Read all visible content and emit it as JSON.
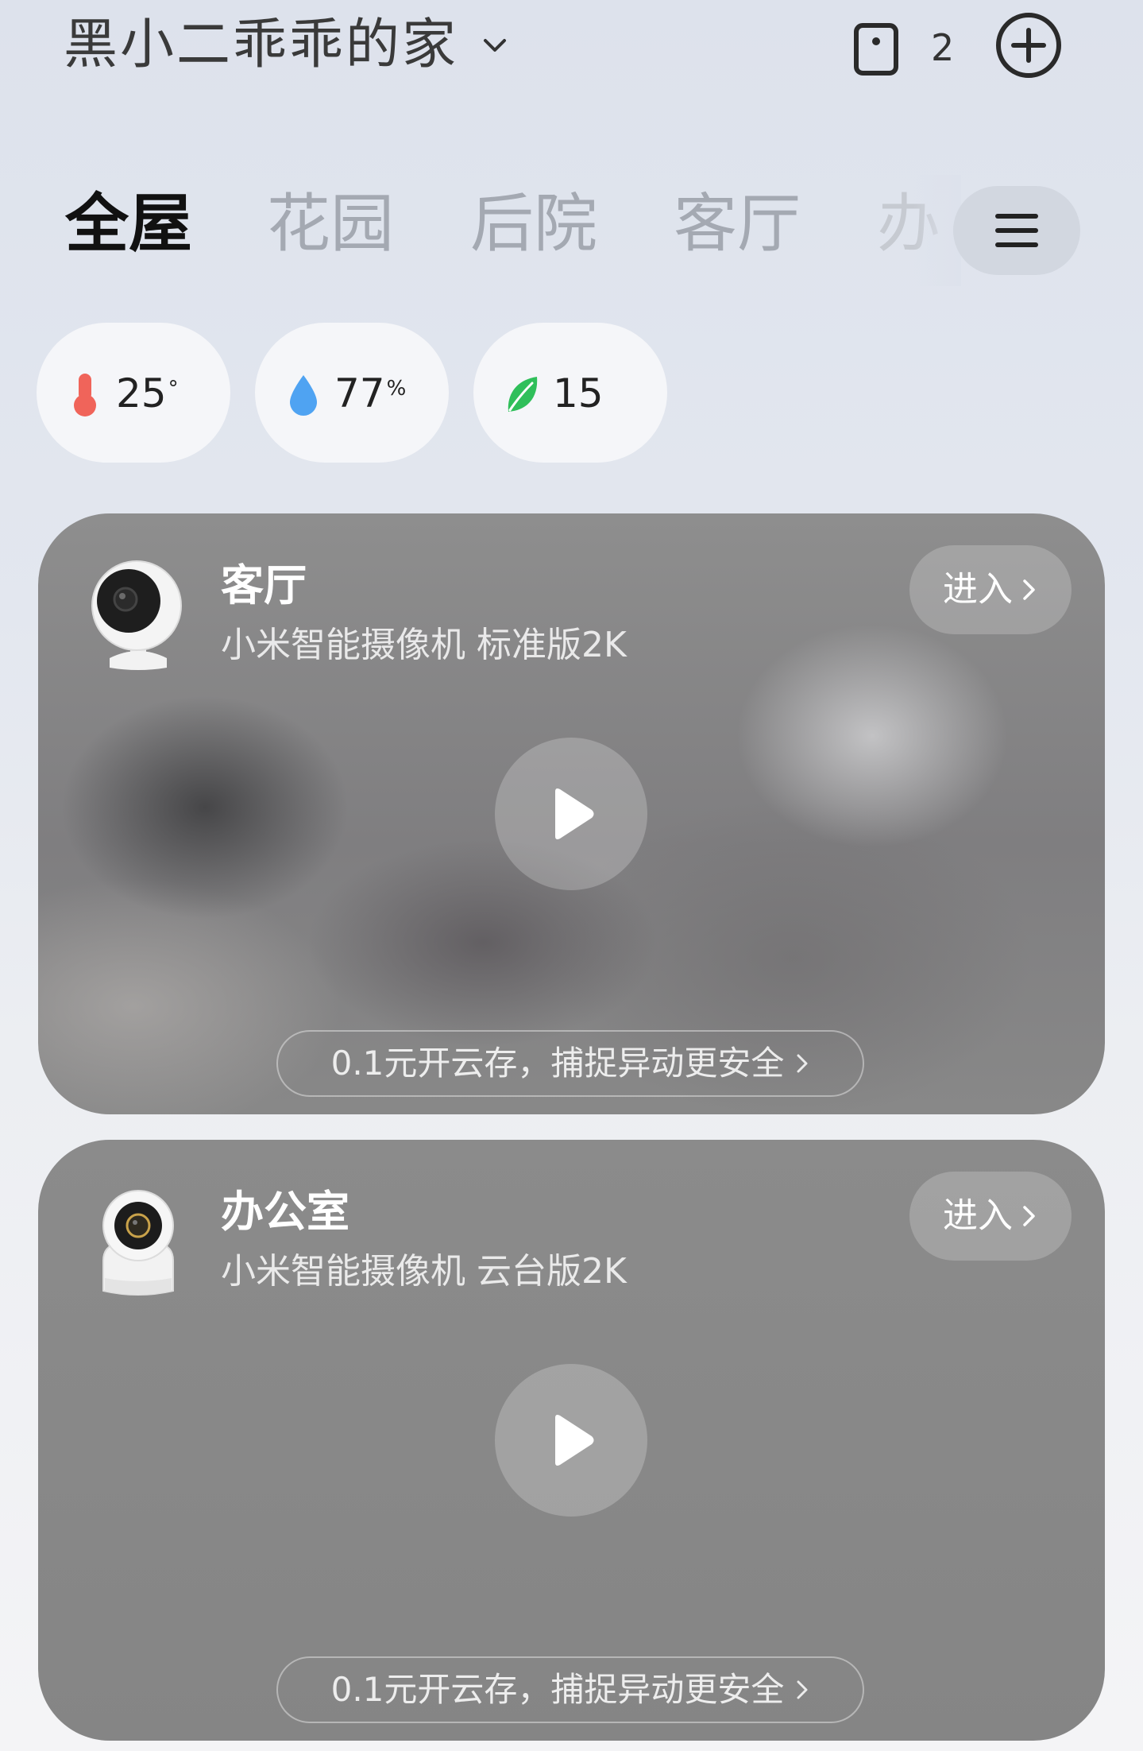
{
  "header": {
    "home_name": "黑小二乖乖的家",
    "device_count": "2",
    "icons": {
      "switch": "chevron-down-icon",
      "device": "tablet-device-icon",
      "add": "plus-circle-icon"
    }
  },
  "tabs": [
    {
      "label": "全屋",
      "active": true
    },
    {
      "label": "花园",
      "active": false
    },
    {
      "label": "后院",
      "active": false
    },
    {
      "label": "客厅",
      "active": false
    },
    {
      "label": "办",
      "active": false
    }
  ],
  "env": {
    "temperature": {
      "value": "25",
      "unit": "°",
      "icon": "thermometer-icon",
      "color": "#f0645a"
    },
    "humidity": {
      "value": "77",
      "unit": "%",
      "icon": "water-drop-icon",
      "color": "#4fa3f2"
    },
    "air_quality": {
      "value": "15",
      "icon": "leaf-icon",
      "color": "#2fbf5a"
    }
  },
  "cameras": [
    {
      "room": "客厅",
      "model": "小米智能摄像机 标准版2K",
      "enter_label": "进入",
      "cloud_promo": "0.1元开云存，捕捉异动更安全"
    },
    {
      "room": "办公室",
      "model": "小米智能摄像机 云台版2K",
      "enter_label": "进入",
      "cloud_promo": "0.1元开云存，捕捉异动更安全"
    }
  ]
}
